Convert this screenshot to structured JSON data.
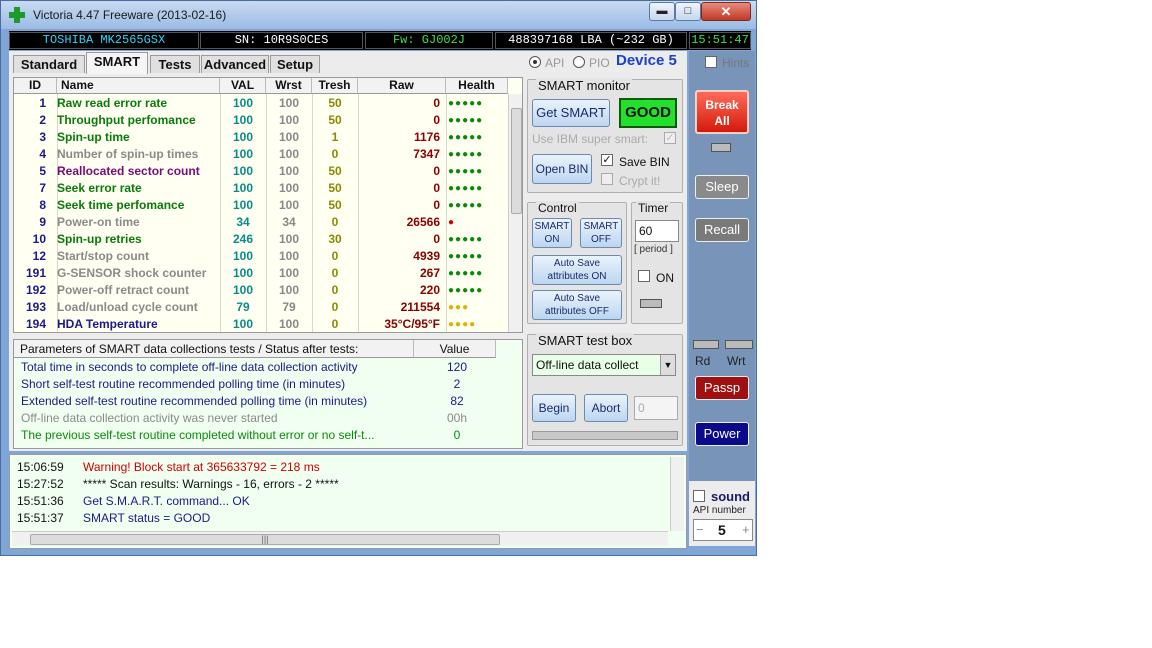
{
  "window": {
    "title": "Victoria 4.47  Freeware (2013-02-16)",
    "min_glyph": "▬",
    "max_glyph": "□",
    "close_glyph": "✕"
  },
  "info": {
    "model": "TOSHIBA MK2565GSX",
    "serial": "SN: 10R9S0CES",
    "firmware": "Fw: GJ002J",
    "lba": "488397168 LBA (~232 GB)",
    "clock": "15:51:47"
  },
  "tabs": [
    "Standard",
    "SMART",
    "Tests",
    "Advanced",
    "Setup"
  ],
  "active_tab": "SMART",
  "interface": {
    "api_label": "API",
    "pio_label": "PIO",
    "selected": "API",
    "device_label": "Device 5"
  },
  "hints_label": "Hints",
  "smart_table": {
    "headers": [
      "ID",
      "Name",
      "VAL",
      "Wrst",
      "Tresh",
      "Raw",
      "Health"
    ],
    "rows": [
      {
        "id": "1",
        "name": "Raw read error rate",
        "val": "100",
        "wrst": "100",
        "tresh": "50",
        "raw": "0",
        "health": "●●●●●",
        "name_color": "#0a7a0a",
        "health_color": "#0a8a0a"
      },
      {
        "id": "2",
        "name": "Throughput perfomance",
        "val": "100",
        "wrst": "100",
        "tresh": "50",
        "raw": "0",
        "health": "●●●●●",
        "name_color": "#0a7a0a",
        "health_color": "#0a8a0a"
      },
      {
        "id": "3",
        "name": "Spin-up time",
        "val": "100",
        "wrst": "100",
        "tresh": "1",
        "raw": "1176",
        "health": "●●●●●",
        "name_color": "#0a7a0a",
        "health_color": "#0a8a0a"
      },
      {
        "id": "4",
        "name": "Number of spin-up times",
        "val": "100",
        "wrst": "100",
        "tresh": "0",
        "raw": "7347",
        "health": "●●●●●",
        "name_color": "#8a8a8a",
        "health_color": "#0a8a0a"
      },
      {
        "id": "5",
        "name": "Reallocated sector count",
        "val": "100",
        "wrst": "100",
        "tresh": "50",
        "raw": "0",
        "health": "●●●●●",
        "name_color": "#7a0a7a",
        "health_color": "#0a8a0a"
      },
      {
        "id": "7",
        "name": "Seek error rate",
        "val": "100",
        "wrst": "100",
        "tresh": "50",
        "raw": "0",
        "health": "●●●●●",
        "name_color": "#0a7a0a",
        "health_color": "#0a8a0a"
      },
      {
        "id": "8",
        "name": "Seek time perfomance",
        "val": "100",
        "wrst": "100",
        "tresh": "50",
        "raw": "0",
        "health": "●●●●●",
        "name_color": "#0a7a0a",
        "health_color": "#0a8a0a"
      },
      {
        "id": "9",
        "name": "Power-on time",
        "val": "34",
        "wrst": "34",
        "tresh": "0",
        "raw": "26566",
        "health": "●",
        "name_color": "#8a8a8a",
        "health_color": "#d00000"
      },
      {
        "id": "10",
        "name": "Spin-up retries",
        "val": "246",
        "wrst": "100",
        "tresh": "30",
        "raw": "0",
        "health": "●●●●●",
        "name_color": "#0a7a0a",
        "health_color": "#0a8a0a"
      },
      {
        "id": "12",
        "name": "Start/stop count",
        "val": "100",
        "wrst": "100",
        "tresh": "0",
        "raw": "4939",
        "health": "●●●●●",
        "name_color": "#8a8a8a",
        "health_color": "#0a8a0a"
      },
      {
        "id": "191",
        "name": "G-SENSOR shock counter",
        "val": "100",
        "wrst": "100",
        "tresh": "0",
        "raw": "267",
        "health": "●●●●●",
        "name_color": "#8a8a8a",
        "health_color": "#0a8a0a"
      },
      {
        "id": "192",
        "name": "Power-off retract count",
        "val": "100",
        "wrst": "100",
        "tresh": "0",
        "raw": "220",
        "health": "●●●●●",
        "name_color": "#8a8a8a",
        "health_color": "#0a8a0a"
      },
      {
        "id": "193",
        "name": "Load/unload cycle count",
        "val": "79",
        "wrst": "79",
        "tresh": "0",
        "raw": "211554",
        "health": "●●●",
        "name_color": "#8a8a8a",
        "health_color": "#e0b000"
      },
      {
        "id": "194",
        "name": "HDA Temperature",
        "val": "100",
        "wrst": "100",
        "tresh": "0",
        "raw": "35°C/95°F",
        "health": "●●●●",
        "name_color": "#1a1a8a",
        "health_color": "#e0b000"
      }
    ]
  },
  "params": {
    "header_label": "Parameters of SMART data collections tests / Status after tests:",
    "header_value": "Value",
    "rows": [
      {
        "label": "Total time in seconds to complete off-line data collection activity",
        "value": "120",
        "color": "#1a1a8a"
      },
      {
        "label": "Short self-test routine recommended polling time (in minutes)",
        "value": "2",
        "color": "#1a1a8a"
      },
      {
        "label": "Extended self-test routine recommended polling time (in minutes)",
        "value": "82",
        "color": "#1a1a8a"
      },
      {
        "label": "Off-line data collection activity was never started",
        "value": "00h",
        "color": "#8a8a8a"
      },
      {
        "label": "The previous self-test routine completed without error or no self-t...",
        "value": "0",
        "color": "#0a8a0a"
      }
    ]
  },
  "smart_monitor": {
    "title": "SMART monitor",
    "get_smart": "Get SMART",
    "status": "GOOD",
    "use_ibm": "Use IBM super smart:",
    "open_bin": "Open BIN",
    "save_bin": "Save BIN",
    "crypt": "Crypt it!"
  },
  "control": {
    "title": "Control",
    "smart_on": "SMART ON",
    "smart_off": "SMART OFF",
    "autosave_on": "Auto Save attributes ON",
    "autosave_off": "Auto Save attributes OFF"
  },
  "timer": {
    "title": "Timer",
    "value": "60",
    "period": "[ period ]",
    "on_label": "ON"
  },
  "smart_test": {
    "title": "SMART test box",
    "selected": "Off-line data collect",
    "begin": "Begin",
    "abort": "Abort",
    "field_value": "0"
  },
  "sidebar": {
    "break_all": "Break All",
    "sleep": "Sleep",
    "recall": "Recall",
    "rd": "Rd",
    "wrt": "Wrt",
    "passp": "Passp",
    "power": "Power",
    "sound": "sound",
    "api_number_label": "API number",
    "api_number": "5",
    "minus": "−",
    "plus": "+"
  },
  "log": [
    {
      "time": "15:06:59",
      "msg": "Warning! Block start at 365633792 = 218 ms",
      "color": "#d00000"
    },
    {
      "time": "15:27:52",
      "msg": "***** Scan results: Warnings - 16, errors - 2 *****",
      "color": "#111111"
    },
    {
      "time": "15:51:36",
      "msg": "Get S.M.A.R.T. command... OK",
      "color": "#1a1a8a"
    },
    {
      "time": "15:51:37",
      "msg": "SMART status = GOOD",
      "color": "#1a1a8a"
    }
  ]
}
